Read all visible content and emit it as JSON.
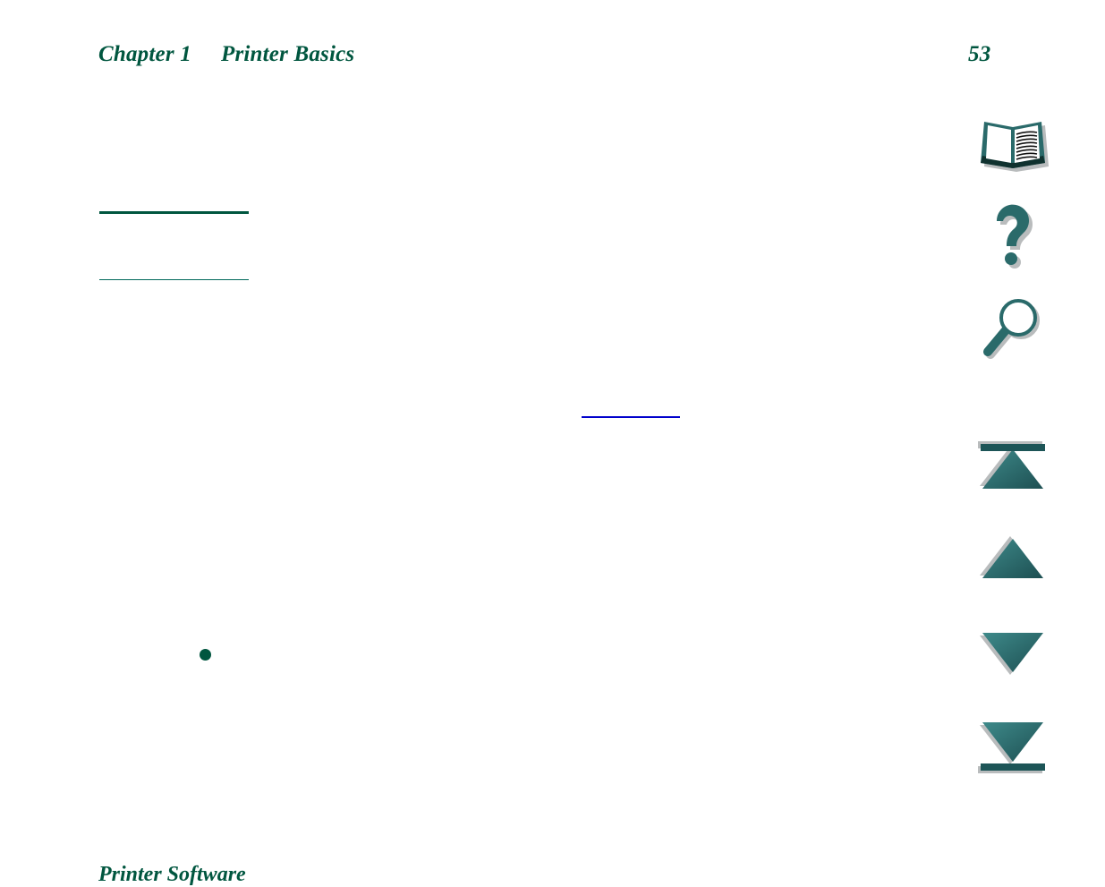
{
  "document": {
    "header": {
      "chapter_label": "Chapter 1",
      "chapter_title": "Printer Basics",
      "page_number": "53"
    },
    "body": {
      "section_heading": "Printer Software",
      "links": [
        {
          "name": "toc-link-rule-1",
          "color": "#00563f",
          "label": ""
        },
        {
          "name": "toc-link-rule-2",
          "color": "#00695a",
          "label": ""
        },
        {
          "name": "inline-link-rule",
          "color": "#0000cc",
          "label": ""
        }
      ],
      "bullet_color": "#00563f"
    }
  },
  "nav": {
    "items": [
      {
        "id": "help-topics",
        "icon": "open-book-icon",
        "label": "Help Topics"
      },
      {
        "id": "help",
        "icon": "question-mark-icon",
        "label": "Help"
      },
      {
        "id": "search",
        "icon": "magnifier-icon",
        "label": "Search"
      },
      {
        "id": "first-page",
        "icon": "triangle-up-bar-icon",
        "label": "First Page"
      },
      {
        "id": "prev-page",
        "icon": "triangle-up-icon",
        "label": "Previous Page"
      },
      {
        "id": "next-page",
        "icon": "triangle-down-icon",
        "label": "Next Page"
      },
      {
        "id": "last-page",
        "icon": "triangle-down-bar-icon",
        "label": "Last Page"
      }
    ]
  },
  "theme": {
    "heading_green": "#00563f",
    "icon_teal": "#2a6a6a",
    "icon_teal_dark": "#1d4f52",
    "link_blue": "#0000cc",
    "page_background": "#ffffff"
  }
}
